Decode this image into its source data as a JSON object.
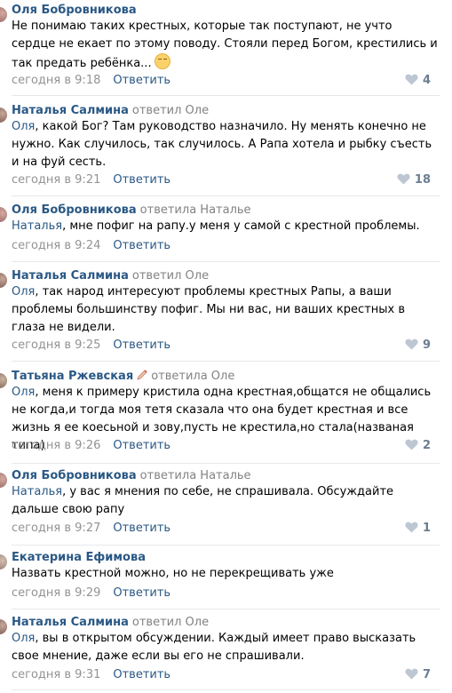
{
  "reply_label": "Ответить",
  "comments": [
    {
      "author": "Оля Бобровникова",
      "reply_to": "",
      "text": "Не понимаю таких крестных, которые так поступают, не учто сердце не екает по этому поводу. Стояли перед Богом, крестились и так предать ребёнка...",
      "date": "сегодня в 9:18",
      "likes": "4"
    },
    {
      "author": "Наталья Салмина",
      "reply_to": "ответил Оле",
      "mention": "Оля",
      "text": ", какой Бог? Там руководство назначило. Ну менять конечно не нужно. Как случилось, так случилось. А Рапа хотела и рыбку съесть и на фуй сесть.",
      "date": "сегодня в 9:21",
      "likes": "18"
    },
    {
      "author": "Оля Бобровникова",
      "reply_to": "ответила Наталье",
      "mention": "Наталья",
      "text": ", мне пофиг на рапу.у меня у самой с крестной проблемы.",
      "date": "сегодня в 9:24",
      "likes": ""
    },
    {
      "author": "Наталья Салмина",
      "reply_to": "ответил Оле",
      "mention": "Оля",
      "text": ", так народ интересуют проблемы крестных Рапы, а ваши проблемы большинству пофиг. Мы ни вас, ни ваших крестных в глаза не видели.",
      "date": "сегодня в 9:25",
      "likes": "9"
    },
    {
      "author": "Татьяна Ржевская",
      "reply_to": "ответила Оле",
      "mention": "Оля",
      "text": ", меня к примеру кристила одна крестная,общатся не общались не когда,и тогда моя тетя сказала что она будет крестная и все жизнь я ее коесьной и зову,пусть не крестила,но стала(названая типа)",
      "date": "сегодня в 9:26",
      "likes": "2"
    },
    {
      "author": "Оля Бобровникова",
      "reply_to": "ответила Наталье",
      "mention": "Наталья",
      "text": ", у вас я мнения по себе, не спрашивала. Обсуждайте дальше свою рапу",
      "date": "сегодня в 9:27",
      "likes": "1"
    },
    {
      "author": "Екатерина Ефимова",
      "reply_to": "",
      "text": "Назвать крестной можно, но не перекрещивать уже",
      "date": "сегодня в 9:29",
      "likes": ""
    },
    {
      "author": "Наталья Салмина",
      "reply_to": "ответил Оле",
      "mention": "Оля",
      "text": ", вы в открытом обсуждении. Каждый имеет право высказать свое мнение, даже если вы его не спрашивали.",
      "date": "сегодня в 9:31",
      "likes": "7"
    }
  ]
}
